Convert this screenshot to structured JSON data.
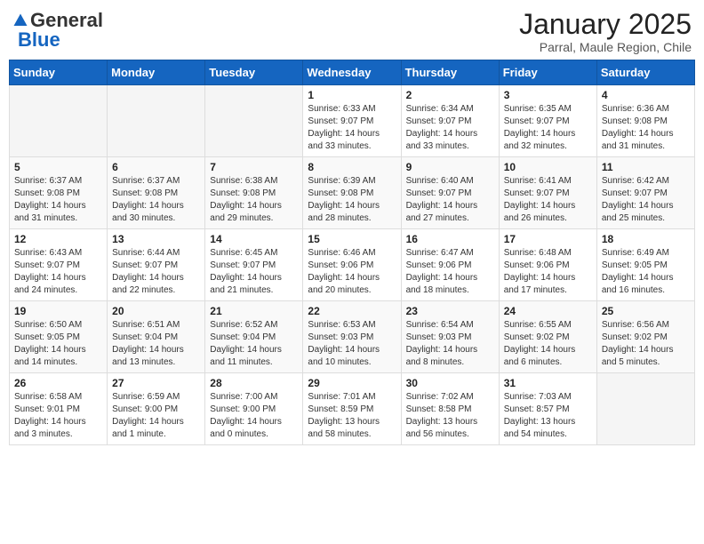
{
  "header": {
    "logo_line1": "General",
    "logo_line2": "Blue",
    "title": "January 2025",
    "subtitle": "Parral, Maule Region, Chile"
  },
  "weekdays": [
    "Sunday",
    "Monday",
    "Tuesday",
    "Wednesday",
    "Thursday",
    "Friday",
    "Saturday"
  ],
  "weeks": [
    [
      {
        "day": "",
        "info": ""
      },
      {
        "day": "",
        "info": ""
      },
      {
        "day": "",
        "info": ""
      },
      {
        "day": "1",
        "info": "Sunrise: 6:33 AM\nSunset: 9:07 PM\nDaylight: 14 hours\nand 33 minutes."
      },
      {
        "day": "2",
        "info": "Sunrise: 6:34 AM\nSunset: 9:07 PM\nDaylight: 14 hours\nand 33 minutes."
      },
      {
        "day": "3",
        "info": "Sunrise: 6:35 AM\nSunset: 9:07 PM\nDaylight: 14 hours\nand 32 minutes."
      },
      {
        "day": "4",
        "info": "Sunrise: 6:36 AM\nSunset: 9:08 PM\nDaylight: 14 hours\nand 31 minutes."
      }
    ],
    [
      {
        "day": "5",
        "info": "Sunrise: 6:37 AM\nSunset: 9:08 PM\nDaylight: 14 hours\nand 31 minutes."
      },
      {
        "day": "6",
        "info": "Sunrise: 6:37 AM\nSunset: 9:08 PM\nDaylight: 14 hours\nand 30 minutes."
      },
      {
        "day": "7",
        "info": "Sunrise: 6:38 AM\nSunset: 9:08 PM\nDaylight: 14 hours\nand 29 minutes."
      },
      {
        "day": "8",
        "info": "Sunrise: 6:39 AM\nSunset: 9:08 PM\nDaylight: 14 hours\nand 28 minutes."
      },
      {
        "day": "9",
        "info": "Sunrise: 6:40 AM\nSunset: 9:07 PM\nDaylight: 14 hours\nand 27 minutes."
      },
      {
        "day": "10",
        "info": "Sunrise: 6:41 AM\nSunset: 9:07 PM\nDaylight: 14 hours\nand 26 minutes."
      },
      {
        "day": "11",
        "info": "Sunrise: 6:42 AM\nSunset: 9:07 PM\nDaylight: 14 hours\nand 25 minutes."
      }
    ],
    [
      {
        "day": "12",
        "info": "Sunrise: 6:43 AM\nSunset: 9:07 PM\nDaylight: 14 hours\nand 24 minutes."
      },
      {
        "day": "13",
        "info": "Sunrise: 6:44 AM\nSunset: 9:07 PM\nDaylight: 14 hours\nand 22 minutes."
      },
      {
        "day": "14",
        "info": "Sunrise: 6:45 AM\nSunset: 9:07 PM\nDaylight: 14 hours\nand 21 minutes."
      },
      {
        "day": "15",
        "info": "Sunrise: 6:46 AM\nSunset: 9:06 PM\nDaylight: 14 hours\nand 20 minutes."
      },
      {
        "day": "16",
        "info": "Sunrise: 6:47 AM\nSunset: 9:06 PM\nDaylight: 14 hours\nand 18 minutes."
      },
      {
        "day": "17",
        "info": "Sunrise: 6:48 AM\nSunset: 9:06 PM\nDaylight: 14 hours\nand 17 minutes."
      },
      {
        "day": "18",
        "info": "Sunrise: 6:49 AM\nSunset: 9:05 PM\nDaylight: 14 hours\nand 16 minutes."
      }
    ],
    [
      {
        "day": "19",
        "info": "Sunrise: 6:50 AM\nSunset: 9:05 PM\nDaylight: 14 hours\nand 14 minutes."
      },
      {
        "day": "20",
        "info": "Sunrise: 6:51 AM\nSunset: 9:04 PM\nDaylight: 14 hours\nand 13 minutes."
      },
      {
        "day": "21",
        "info": "Sunrise: 6:52 AM\nSunset: 9:04 PM\nDaylight: 14 hours\nand 11 minutes."
      },
      {
        "day": "22",
        "info": "Sunrise: 6:53 AM\nSunset: 9:03 PM\nDaylight: 14 hours\nand 10 minutes."
      },
      {
        "day": "23",
        "info": "Sunrise: 6:54 AM\nSunset: 9:03 PM\nDaylight: 14 hours\nand 8 minutes."
      },
      {
        "day": "24",
        "info": "Sunrise: 6:55 AM\nSunset: 9:02 PM\nDaylight: 14 hours\nand 6 minutes."
      },
      {
        "day": "25",
        "info": "Sunrise: 6:56 AM\nSunset: 9:02 PM\nDaylight: 14 hours\nand 5 minutes."
      }
    ],
    [
      {
        "day": "26",
        "info": "Sunrise: 6:58 AM\nSunset: 9:01 PM\nDaylight: 14 hours\nand 3 minutes."
      },
      {
        "day": "27",
        "info": "Sunrise: 6:59 AM\nSunset: 9:00 PM\nDaylight: 14 hours\nand 1 minute."
      },
      {
        "day": "28",
        "info": "Sunrise: 7:00 AM\nSunset: 9:00 PM\nDaylight: 14 hours\nand 0 minutes."
      },
      {
        "day": "29",
        "info": "Sunrise: 7:01 AM\nSunset: 8:59 PM\nDaylight: 13 hours\nand 58 minutes."
      },
      {
        "day": "30",
        "info": "Sunrise: 7:02 AM\nSunset: 8:58 PM\nDaylight: 13 hours\nand 56 minutes."
      },
      {
        "day": "31",
        "info": "Sunrise: 7:03 AM\nSunset: 8:57 PM\nDaylight: 13 hours\nand 54 minutes."
      },
      {
        "day": "",
        "info": ""
      }
    ]
  ]
}
